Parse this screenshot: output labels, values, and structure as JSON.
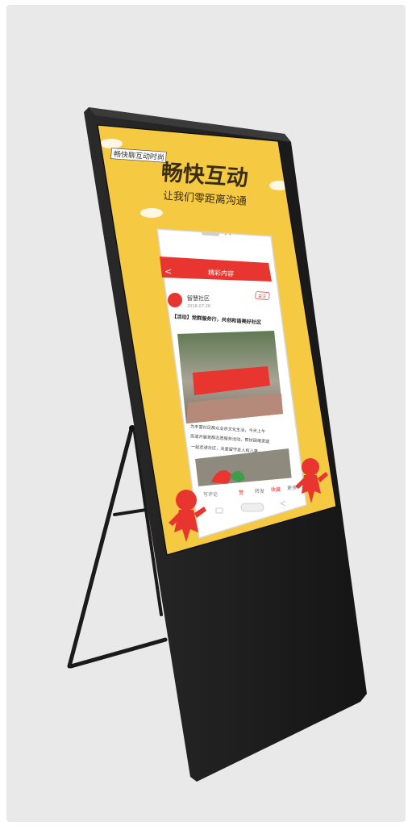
{
  "scene": {
    "backdrop_color": "#e9e9e9",
    "kiosk_frame_color": "#1c1c1c",
    "screen_bg_color": "#f5c942",
    "accent_red": "#e8352f"
  },
  "screen": {
    "corner_tag": "畅快聊互动时尚",
    "headline": "畅快互动",
    "subheadline": "让我们零距离沟通"
  },
  "phone": {
    "speaker_dots": "• •",
    "app_header_title": "精彩内容",
    "back_arrow": "<",
    "account_name": "智慧社区",
    "account_meta": "2018-07-26",
    "follow_label": "关注",
    "article_title": "【活动】党群服务行，共创和谐美好社区",
    "body_line_1": "为丰富社区群众业余文化生活，今天上午",
    "body_line_2": "街道开展党群志愿服务活动，帮扶困难家庭",
    "body_line_3": "一起走进社区，关爱留守老人和儿童。",
    "action_bar": {
      "comment_label": "写评论",
      "items": [
        "赞",
        "转发",
        "收藏",
        "更多"
      ]
    }
  }
}
